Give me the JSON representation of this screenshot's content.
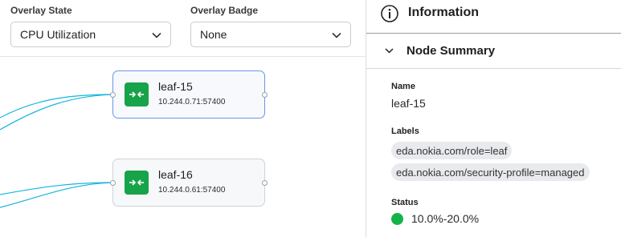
{
  "toolbar": {
    "overlay_state_label": "Overlay State",
    "overlay_state_value": "CPU Utilization",
    "overlay_badge_label": "Overlay Badge",
    "overlay_badge_value": "None"
  },
  "topology": {
    "link_color": "#17b4df",
    "badge_color": "#16a34a",
    "nodes": [
      {
        "name": "leaf-15",
        "address": "10.244.0.71:57400",
        "selected": true
      },
      {
        "name": "leaf-16",
        "address": "10.244.0.61:57400",
        "selected": false
      }
    ]
  },
  "panel": {
    "title": "Information",
    "section_title": "Node Summary",
    "name_label": "Name",
    "name_value": "leaf-15",
    "labels_label": "Labels",
    "labels": [
      "eda.nokia.com/role=leaf",
      "eda.nokia.com/security-profile=managed"
    ],
    "status_label": "Status",
    "status_value": "10.0%-20.0%",
    "status_color": "#14b34a"
  }
}
